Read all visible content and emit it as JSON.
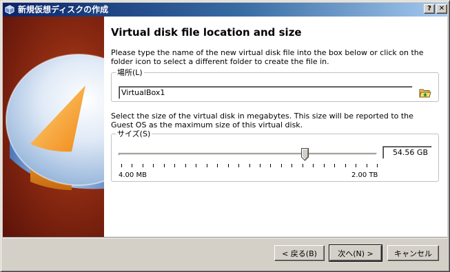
{
  "window": {
    "title": "新規仮想ディスクの作成",
    "help_glyph": "?",
    "close_glyph": "✕"
  },
  "page": {
    "title": "Virtual disk file location and size",
    "location_description": "Please type the name of the new virtual disk file into the box below or click on the folder icon to select a different folder to create the file in.",
    "size_description": "Select the size of the virtual disk in megabytes. This size will be reported to the Guest OS as the maximum size of this virtual disk."
  },
  "location": {
    "group_label": "場所(L)",
    "value": "VirtualBox1",
    "folder_icon": "folder-open-icon"
  },
  "size": {
    "group_label": "サイズ(S)",
    "value": "54.56 GB",
    "min_label": "4.00 MB",
    "max_label": "2.00 TB",
    "slider_fraction": 0.72,
    "tick_count": 25
  },
  "buttons": {
    "back": "< 戻る(B)",
    "next": "次へ(N) >",
    "cancel": "キャンセル"
  },
  "colors": {
    "titlebar_start": "#0a246a",
    "titlebar_end": "#a6caf0",
    "banner": "#8c2a12",
    "disk_highlight": "#f5a623"
  }
}
